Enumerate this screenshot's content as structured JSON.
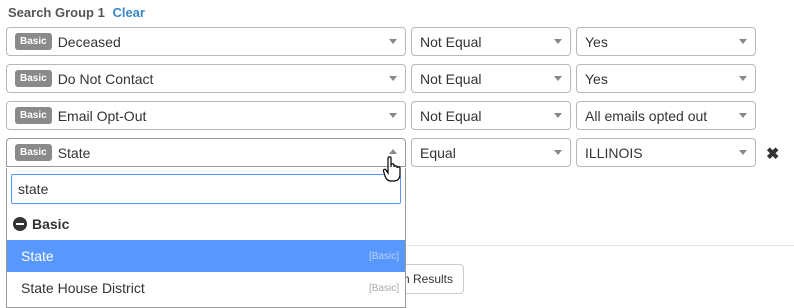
{
  "group": {
    "title": "Search Group 1",
    "clear_label": "Clear"
  },
  "rows": [
    {
      "badge": "Basic",
      "field": "Deceased",
      "operator": "Not Equal",
      "value": "Yes"
    },
    {
      "badge": "Basic",
      "field": "Do Not Contact",
      "operator": "Not Equal",
      "value": "Yes"
    },
    {
      "badge": "Basic",
      "field": "Email Opt-Out",
      "operator": "Not Equal",
      "value": "All emails opted out"
    },
    {
      "badge": "Basic",
      "field": "State",
      "operator": "Equal",
      "value": "ILLINOIS"
    }
  ],
  "dropdown": {
    "search_value": "state",
    "group_label": "Basic",
    "options": [
      {
        "label": "State",
        "tag": "[Basic]",
        "highlighted": true
      },
      {
        "label": "State House District",
        "tag": "[Basic]",
        "highlighted": false
      }
    ]
  },
  "search_button_label": "h Results",
  "icons": {
    "remove": "close-icon",
    "group_toggle": "minus-circle-icon",
    "caret": "caret-icon",
    "cursor": "hand-pointer-icon"
  }
}
